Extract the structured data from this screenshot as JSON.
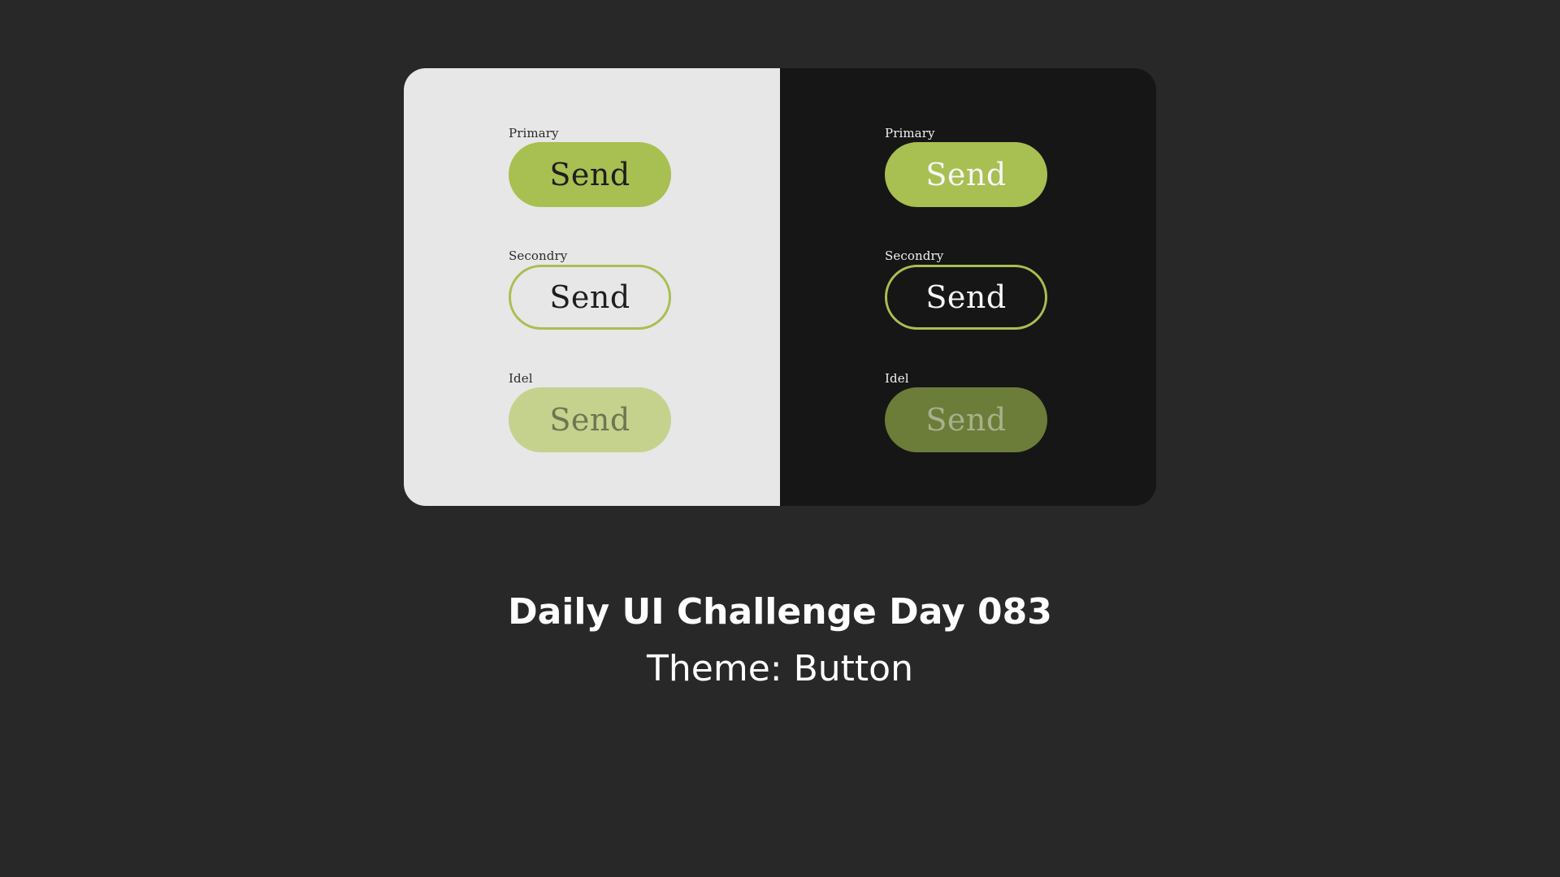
{
  "colors": {
    "page_background": "#282828",
    "light_panel": "#e7e7e7",
    "dark_panel": "#161616",
    "accent_green": "#a8bf52",
    "idle_light": "#c4d28e",
    "idle_dark": "#6b7d38"
  },
  "light_panel": {
    "primary": {
      "label": "Primary",
      "button": "Send"
    },
    "secondary": {
      "label": "Secondry",
      "button": "Send"
    },
    "idle": {
      "label": "Idel",
      "button": "Send"
    }
  },
  "dark_panel": {
    "primary": {
      "label": "Primary",
      "button": "Send"
    },
    "secondary": {
      "label": "Secondry",
      "button": "Send"
    },
    "idle": {
      "label": "Idel",
      "button": "Send"
    }
  },
  "caption": {
    "title": "Daily UI Challenge Day 083",
    "subtitle": "Theme: Button"
  }
}
